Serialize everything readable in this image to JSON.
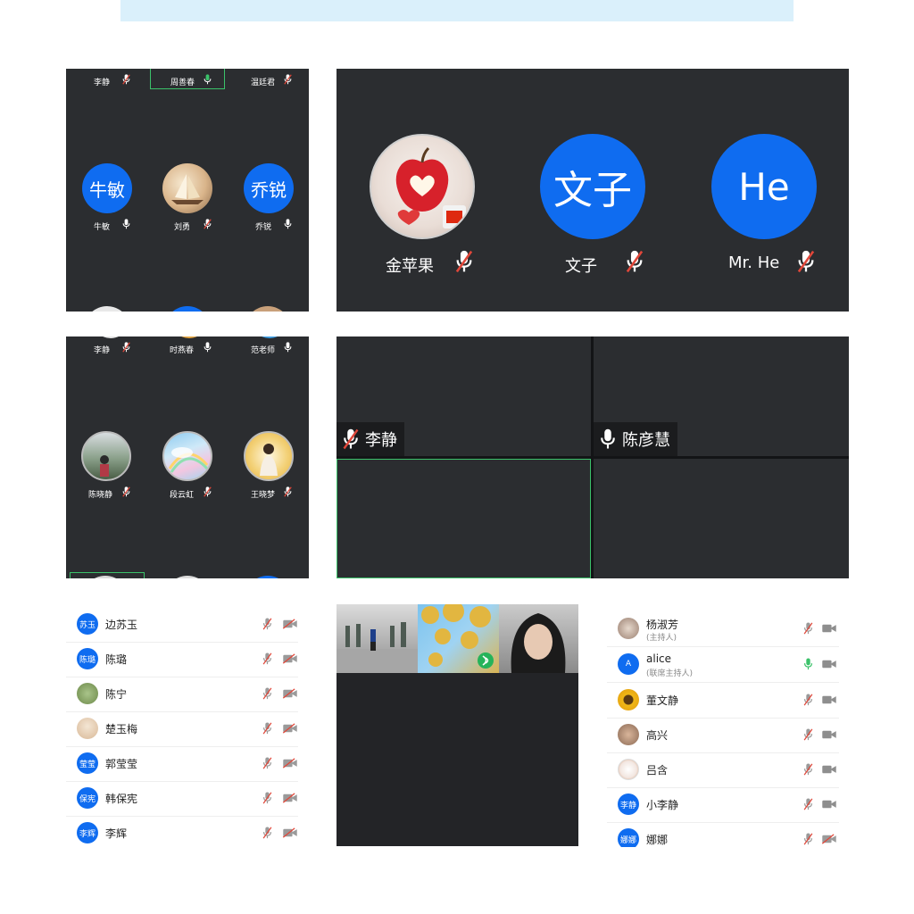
{
  "panel1": {
    "top_labels": [
      "李静",
      "周善春",
      "温廷君"
    ],
    "tiles": [
      {
        "name": "牛敏",
        "avatar_text": "牛敏"
      },
      {
        "name": "刘勇",
        "avatar_text": ""
      },
      {
        "name": "乔锐",
        "avatar_text": "乔锐"
      }
    ]
  },
  "panel2": {
    "tiles": [
      {
        "name": "金苹果",
        "avatar_text": ""
      },
      {
        "name": "文子",
        "avatar_text": "文子"
      },
      {
        "name": "Mr. He",
        "avatar_text": "He"
      }
    ]
  },
  "panel3": {
    "top_labels": [
      "李静",
      "时燕春",
      "范老师"
    ],
    "tiles": [
      {
        "name": "陈晓静"
      },
      {
        "name": "段云虹"
      },
      {
        "name": "王晓梦"
      }
    ]
  },
  "panel4": {
    "tiles": [
      {
        "name": "李静"
      },
      {
        "name": "陈彦慧"
      }
    ]
  },
  "list1": [
    {
      "name": "边苏玉",
      "avatar_text": "苏玉"
    },
    {
      "name": "陈璐",
      "avatar_text": "陈璐"
    },
    {
      "name": "陈宁",
      "avatar_text": ""
    },
    {
      "name": "楚玉梅",
      "avatar_text": ""
    },
    {
      "name": "郭莹莹",
      "avatar_text": "莹莹"
    },
    {
      "name": "韩保宪",
      "avatar_text": "保宪"
    },
    {
      "name": "李辉",
      "avatar_text": "李辉"
    }
  ],
  "list2": [
    {
      "name": "杨淑芳",
      "role": "(主持人)",
      "avatar_text": ""
    },
    {
      "name": "alice",
      "role": "(联席主持人)",
      "avatar_text": "A"
    },
    {
      "name": "董文静",
      "role": "",
      "avatar_text": ""
    },
    {
      "name": "高兴",
      "role": "",
      "avatar_text": ""
    },
    {
      "name": "吕含",
      "role": "",
      "avatar_text": ""
    },
    {
      "name": "小李静",
      "role": "",
      "avatar_text": "李静"
    },
    {
      "name": "娜娜",
      "role": "",
      "avatar_text": "娜娜"
    }
  ],
  "colors": {
    "accent": "#0f6cf0",
    "panel_bg": "#2b2d30",
    "mute": "#e0473a",
    "active": "#3bc26a"
  }
}
